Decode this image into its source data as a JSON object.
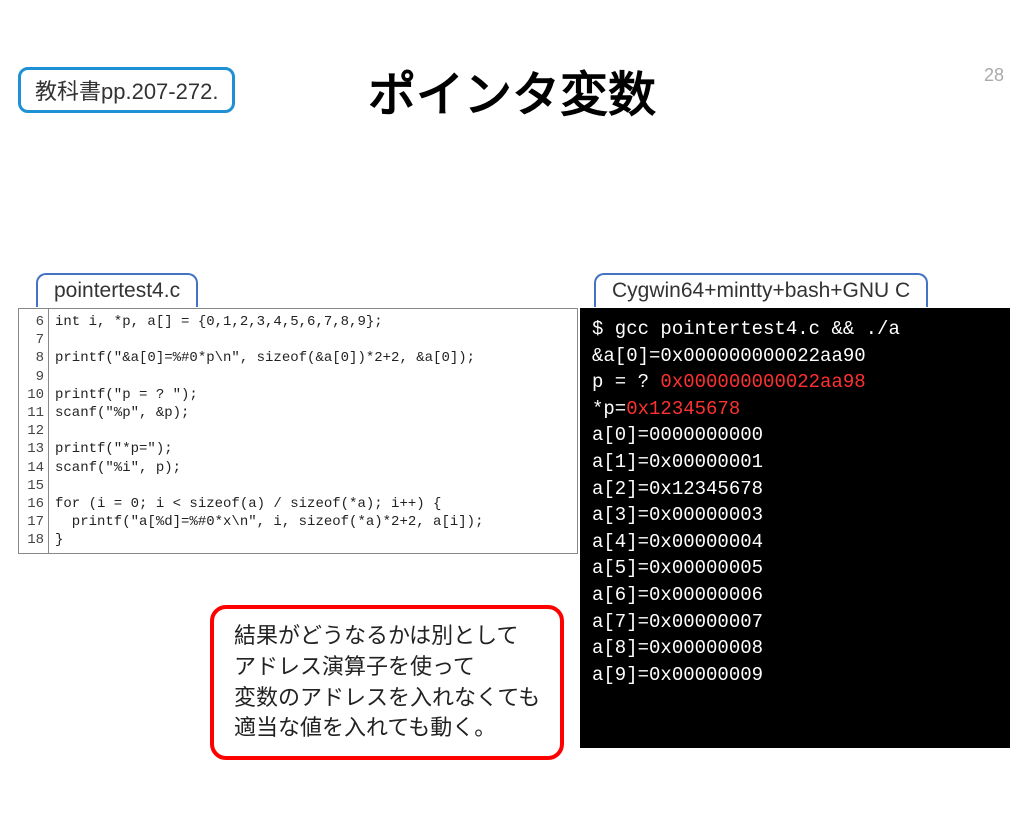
{
  "page_number": "28",
  "textbook_ref": "教科書pp.207-272.",
  "title": "ポインタ変数",
  "code_tab": "pointertest4.c",
  "term_tab": "Cygwin64+mintty+bash+GNU C",
  "code_lines": [
    {
      "n": "6",
      "t": "int i, *p, a[] = {0,1,2,3,4,5,6,7,8,9};"
    },
    {
      "n": "7",
      "t": ""
    },
    {
      "n": "8",
      "t": "printf(\"&a[0]=%#0*p\\n\", sizeof(&a[0])*2+2, &a[0]);"
    },
    {
      "n": "9",
      "t": ""
    },
    {
      "n": "10",
      "t": "printf(\"p = ? \");"
    },
    {
      "n": "11",
      "t": "scanf(\"%p\", &p);"
    },
    {
      "n": "12",
      "t": ""
    },
    {
      "n": "13",
      "t": "printf(\"*p=\");"
    },
    {
      "n": "14",
      "t": "scanf(\"%i\", p);"
    },
    {
      "n": "15",
      "t": ""
    },
    {
      "n": "16",
      "t": "for (i = 0; i < sizeof(a) / sizeof(*a); i++) {"
    },
    {
      "n": "17",
      "t": "  printf(\"a[%d]=%#0*x\\n\", i, sizeof(*a)*2+2, a[i]);"
    },
    {
      "n": "18",
      "t": "}"
    }
  ],
  "term_lines": [
    {
      "text": "$ gcc pointertest4.c && ./a",
      "red": false
    },
    {
      "text": "&a[0]=0x000000000022aa90",
      "red": false
    },
    {
      "text": "p = ? ",
      "red": false,
      "suffix": "0x000000000022aa98",
      "suffix_red": true
    },
    {
      "text": "*p=",
      "red": false,
      "suffix": "0x12345678",
      "suffix_red": true
    },
    {
      "text": "a[0]=0000000000",
      "red": false
    },
    {
      "text": "a[1]=0x00000001",
      "red": false
    },
    {
      "text": "a[2]=0x12345678",
      "red": false
    },
    {
      "text": "a[3]=0x00000003",
      "red": false
    },
    {
      "text": "a[4]=0x00000004",
      "red": false
    },
    {
      "text": "a[5]=0x00000005",
      "red": false
    },
    {
      "text": "a[6]=0x00000006",
      "red": false
    },
    {
      "text": "a[7]=0x00000007",
      "red": false
    },
    {
      "text": "a[8]=0x00000008",
      "red": false
    },
    {
      "text": "a[9]=0x00000009",
      "red": false
    }
  ],
  "callout": {
    "l1": "結果がどうなるかは別として",
    "l2": "アドレス演算子を使って",
    "l3": "変数のアドレスを入れなくても",
    "l4": "適当な値を入れても動く。"
  }
}
